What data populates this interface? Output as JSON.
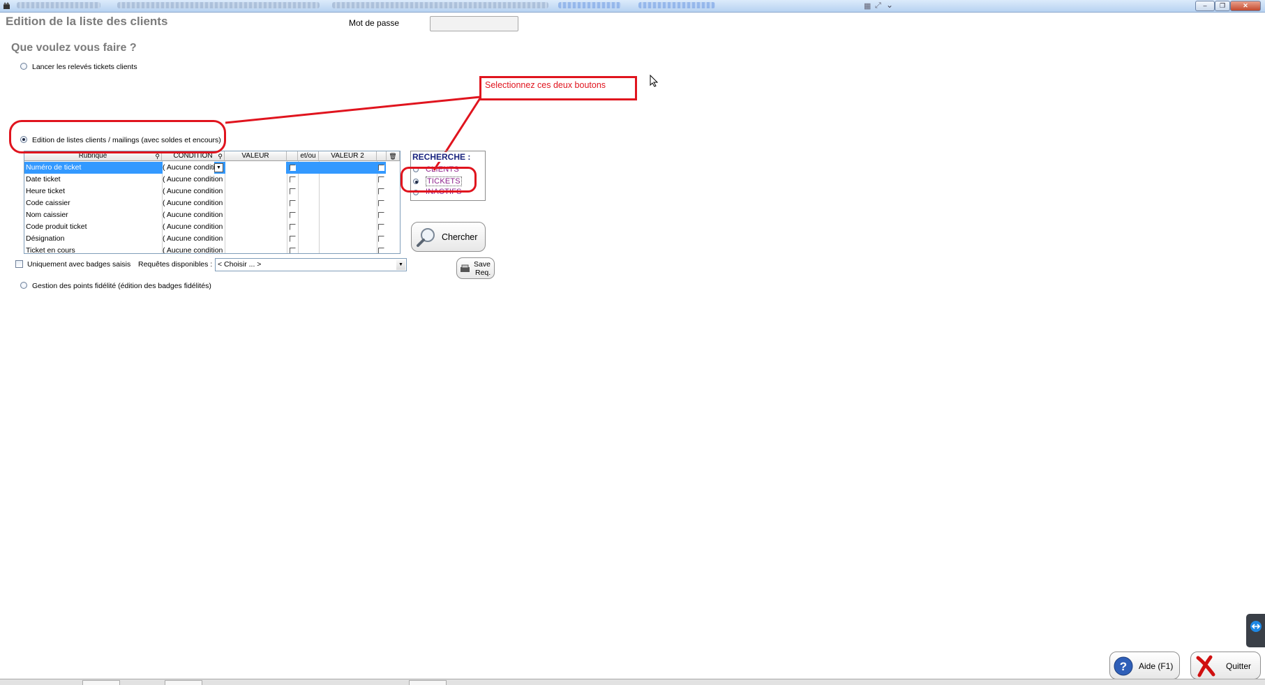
{
  "page_title": "Edition de la liste des clients",
  "password_label": "Mot de passe",
  "password_value": "",
  "question": "Que voulez vous faire ?",
  "options": {
    "lancer": "Lancer les relevés tickets clients",
    "edition": "Edition de listes clients / mailings (avec soldes et encours)",
    "gestion": "Gestion des points fidélité (édition des badges fidélités)"
  },
  "callout": "Selectionnez ces deux boutons",
  "grid": {
    "headers": [
      "Rubrique",
      "CONDITION",
      "VALEUR",
      "et/ou",
      "VALEUR 2"
    ],
    "rows": [
      {
        "rubrique": "Numéro de ticket",
        "condition": "( Aucune conditio"
      },
      {
        "rubrique": "Date ticket",
        "condition": "( Aucune condition )"
      },
      {
        "rubrique": "Heure ticket",
        "condition": "( Aucune condition )"
      },
      {
        "rubrique": "Code caissier",
        "condition": "( Aucune condition )"
      },
      {
        "rubrique": "Nom caissier",
        "condition": "( Aucune condition )"
      },
      {
        "rubrique": "Code produit ticket",
        "condition": "( Aucune condition )"
      },
      {
        "rubrique": "Désignation",
        "condition": "( Aucune condition )"
      },
      {
        "rubrique": "Ticket en cours",
        "condition": "( Aucune condition )"
      }
    ]
  },
  "recherche": {
    "title": "RECHERCHE :",
    "items": [
      "CLIENTS",
      "TICKETS",
      "INACTIFS"
    ],
    "selected": "TICKETS"
  },
  "chercher_label": "Chercher",
  "save_req_line1": "Save",
  "save_req_line2": "Req.",
  "badges_checkbox_label": "Uniquement avec badges saisis",
  "requetes_label": "Requêtes disponibles :",
  "requetes_value": "< Choisir ... >",
  "aide_label": "Aide (F1)",
  "quitter_label": "Quitter",
  "colors": {
    "accent_red": "#e0141e",
    "selection_blue": "#3399ff",
    "recherche_blue": "#1a237e",
    "recherche_item": "#8a1e8a"
  }
}
